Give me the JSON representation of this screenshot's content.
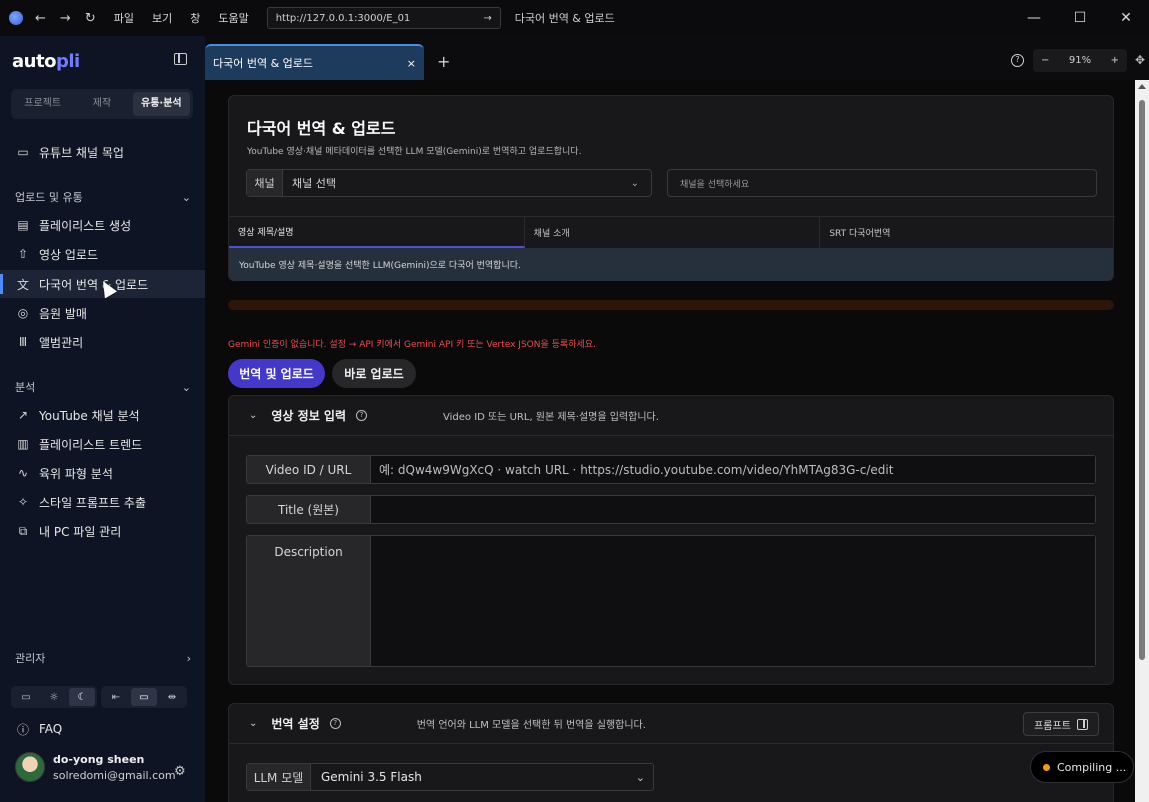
{
  "titlebar": {
    "menu": [
      "파일",
      "보기",
      "창",
      "도움말"
    ],
    "url": "http://127.0.0.1:3000/E_01",
    "title": "다국어 번역 & 업로드"
  },
  "sidebar": {
    "logo_a": "auto",
    "logo_b": "pli",
    "segments": [
      "프로젝트",
      "제작",
      "유통·분석"
    ],
    "active_segment": 2,
    "top_item": "유튜브 채널 목업",
    "section_upload": "업로드 및 유통",
    "upload_items": [
      "플레이리스트 생성",
      "영상 업로드",
      "다국어 번역 & 업로드",
      "음원 발매",
      "앨범관리"
    ],
    "active_item": "다국어 번역 & 업로드",
    "section_analysis": "분석",
    "analysis_items": [
      "YouTube 채널 분석",
      "플레이리스트 트렌드",
      "육위 파형 분석",
      "스타일 프롬프트 추출",
      "내 PC 파일 관리"
    ],
    "admin": "관리자",
    "faq": "FAQ",
    "user_name": "do-yong sheen",
    "user_email": "solredomi@gmail.com"
  },
  "tabs": {
    "active": "다국어 번역 & 업로드",
    "zoom": "91%"
  },
  "page": {
    "title": "다국어 번역 & 업로드",
    "subtitle": "YouTube 영상·채널 메타데이터를 선택한 LLM 모델(Gemini)로 번역하고 업로드합니다.",
    "channel_label": "채널",
    "channel_value": "채널 선택",
    "channel_placeholder": "채널을 선택하세요",
    "subtabs": [
      "영상 제목/설명",
      "채널 소개",
      "SRT 다국어번역"
    ],
    "subtab_desc": "YouTube 영상 제목·설명을 선택한 LLM(Gemini)으로 다국어 번역합니다.",
    "progress": 0,
    "warning": "Gemini 인증이 없습니다. 설정 → API 키에서 Gemini API 키 또는 Vertex JSON을 등록하세요.",
    "btn_translate": "번역 및 업로드",
    "btn_direct": "바로 업로드"
  },
  "video_card": {
    "title": "영상 정보 입력",
    "desc": "Video ID 또는 URL, 원본 제목·설명을 입력합니다.",
    "id_label": "Video ID / URL",
    "id_placeholder": "예: dQw4w9WgXcQ · watch URL · https://studio.youtube.com/video/YhMTAg83G-c/edit",
    "title_label": "Title (원본)",
    "desc_label": "Description"
  },
  "translate_card": {
    "title": "번역 설정",
    "desc": "번역 언어와 LLM 모델을 선택한 뒤 번역을 실행합니다.",
    "prompt_btn": "프롬프트",
    "llm_label": "LLM 모델",
    "llm_value": "Gemini 3.5 Flash"
  },
  "status": {
    "compiling": "Compiling ..."
  },
  "colors": {
    "accent": "#4338ca",
    "tab_active": "#1d3b5c",
    "warning": "#ee4b4b",
    "progress": "#b6500e"
  }
}
